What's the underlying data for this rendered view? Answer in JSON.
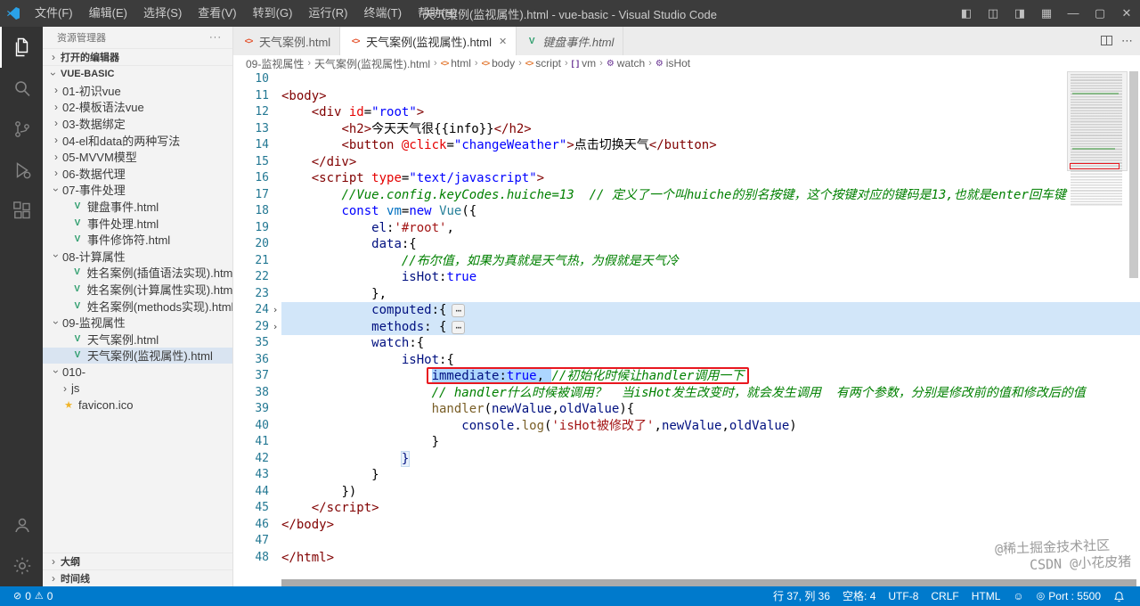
{
  "titlebar": {
    "menus": [
      "文件(F)",
      "编辑(E)",
      "选择(S)",
      "查看(V)",
      "转到(G)",
      "运行(R)",
      "终端(T)",
      "帮助(H)"
    ],
    "title": "天气案例(监视属性).html - vue-basic - Visual Studio Code"
  },
  "sidebar": {
    "title": "资源管理器",
    "open_editors_label": "打开的编辑器",
    "workspace_label": "VUE-BASIC",
    "outline_label": "大纲",
    "timeline_label": "时间线",
    "tree": [
      {
        "label": "01-初识vue",
        "kind": "folder",
        "state": "collapsed",
        "depth": 0
      },
      {
        "label": "02-模板语法vue",
        "kind": "folder",
        "state": "collapsed",
        "depth": 0
      },
      {
        "label": "03-数据绑定",
        "kind": "folder",
        "state": "collapsed",
        "depth": 0
      },
      {
        "label": "04-el和data的两种写法",
        "kind": "folder",
        "state": "collapsed",
        "depth": 0
      },
      {
        "label": "05-MVVM模型",
        "kind": "folder",
        "state": "collapsed",
        "depth": 0
      },
      {
        "label": "06-数据代理",
        "kind": "folder",
        "state": "collapsed",
        "depth": 0
      },
      {
        "label": "07-事件处理",
        "kind": "folder",
        "state": "expanded",
        "depth": 0
      },
      {
        "label": "键盘事件.html",
        "kind": "file",
        "icon": "vue",
        "depth": 1
      },
      {
        "label": "事件处理.html",
        "kind": "file",
        "icon": "vue",
        "depth": 1
      },
      {
        "label": "事件修饰符.html",
        "kind": "file",
        "icon": "vue",
        "depth": 1
      },
      {
        "label": "08-计算属性",
        "kind": "folder",
        "state": "expanded",
        "depth": 0
      },
      {
        "label": "姓名案例(插值语法实现).html",
        "kind": "file",
        "icon": "vue",
        "depth": 1
      },
      {
        "label": "姓名案例(计算属性实现).html",
        "kind": "file",
        "icon": "vue",
        "depth": 1
      },
      {
        "label": "姓名案例(methods实现).html",
        "kind": "file",
        "icon": "vue",
        "depth": 1
      },
      {
        "label": "09-监视属性",
        "kind": "folder",
        "state": "expanded",
        "depth": 0
      },
      {
        "label": "天气案例.html",
        "kind": "file",
        "icon": "vue",
        "depth": 1
      },
      {
        "label": "天气案例(监视属性).html",
        "kind": "file",
        "icon": "vue",
        "depth": 1,
        "selected": true
      },
      {
        "label": "010-",
        "kind": "folder",
        "state": "expanded",
        "depth": 0
      },
      {
        "label": "js",
        "kind": "folder",
        "state": "collapsed",
        "depth": 1
      },
      {
        "label": "favicon.ico",
        "kind": "file",
        "icon": "star",
        "depth": 0
      }
    ]
  },
  "tabs": [
    {
      "label": "天气案例.html",
      "icon": "html",
      "active": false,
      "preview": false
    },
    {
      "label": "天气案例(监视属性).html",
      "icon": "html",
      "active": true,
      "preview": false
    },
    {
      "label": "键盘事件.html",
      "icon": "vue",
      "active": false,
      "preview": true
    }
  ],
  "breadcrumbs": [
    {
      "label": "09-监视属性",
      "icon": ""
    },
    {
      "label": "天气案例(监视属性).html",
      "icon": ""
    },
    {
      "label": "html",
      "icon": "tag"
    },
    {
      "label": "body",
      "icon": "tag"
    },
    {
      "label": "script",
      "icon": "tag"
    },
    {
      "label": "vm",
      "icon": "field"
    },
    {
      "label": "watch",
      "icon": "method"
    },
    {
      "label": "isHot",
      "icon": "method"
    }
  ],
  "editor": {
    "highlighted_line": 37,
    "lines": [
      {
        "n": 10,
        "tk": []
      },
      {
        "n": 11,
        "tk": [
          {
            "t": "<body>",
            "c": "tag"
          }
        ]
      },
      {
        "n": 12,
        "tk": [
          {
            "t": "    ",
            "c": "pln"
          },
          {
            "t": "<div",
            "c": "tag"
          },
          {
            "t": " ",
            "c": "pln"
          },
          {
            "t": "id",
            "c": "attr"
          },
          {
            "t": "=",
            "c": "pln"
          },
          {
            "t": "\"root\"",
            "c": "aval"
          },
          {
            "t": ">",
            "c": "tag"
          }
        ]
      },
      {
        "n": 13,
        "tk": [
          {
            "t": "        ",
            "c": "pln"
          },
          {
            "t": "<h2>",
            "c": "tag"
          },
          {
            "t": "今天天气很{{info}}",
            "c": "pln"
          },
          {
            "t": "</h2>",
            "c": "tag"
          }
        ]
      },
      {
        "n": 14,
        "tk": [
          {
            "t": "        ",
            "c": "pln"
          },
          {
            "t": "<button",
            "c": "tag"
          },
          {
            "t": " ",
            "c": "pln"
          },
          {
            "t": "@click",
            "c": "attr"
          },
          {
            "t": "=",
            "c": "pln"
          },
          {
            "t": "\"changeWeather\"",
            "c": "aval"
          },
          {
            "t": ">",
            "c": "tag"
          },
          {
            "t": "点击切换天气",
            "c": "pln"
          },
          {
            "t": "</button>",
            "c": "tag"
          }
        ]
      },
      {
        "n": 15,
        "tk": [
          {
            "t": "    ",
            "c": "pln"
          },
          {
            "t": "</div>",
            "c": "tag"
          }
        ]
      },
      {
        "n": 16,
        "tk": [
          {
            "t": "    ",
            "c": "pln"
          },
          {
            "t": "<script",
            "c": "tag"
          },
          {
            "t": " ",
            "c": "pln"
          },
          {
            "t": "type",
            "c": "attr"
          },
          {
            "t": "=",
            "c": "pln"
          },
          {
            "t": "\"text/javascript\"",
            "c": "aval"
          },
          {
            "t": ">",
            "c": "tag"
          }
        ]
      },
      {
        "n": 17,
        "tk": [
          {
            "t": "        ",
            "c": "pln"
          },
          {
            "t": "//Vue.config.keyCodes.huiche=13  // 定义了一个叫huiche的别名按键，这个按键对应的键码是13,也就是enter回车键",
            "c": "cmt"
          }
        ]
      },
      {
        "n": 18,
        "tk": [
          {
            "t": "        ",
            "c": "pln"
          },
          {
            "t": "const",
            "c": "kw"
          },
          {
            "t": " ",
            "c": "pln"
          },
          {
            "t": "vm",
            "c": "vconst"
          },
          {
            "t": "=",
            "c": "pln"
          },
          {
            "t": "new",
            "c": "kw"
          },
          {
            "t": " ",
            "c": "pln"
          },
          {
            "t": "Vue",
            "c": "cls"
          },
          {
            "t": "({",
            "c": "pln"
          }
        ]
      },
      {
        "n": 19,
        "tk": [
          {
            "t": "            ",
            "c": "pln"
          },
          {
            "t": "el",
            "c": "prop"
          },
          {
            "t": ":",
            "c": "pln"
          },
          {
            "t": "'#root'",
            "c": "str"
          },
          {
            "t": ",",
            "c": "pln"
          }
        ]
      },
      {
        "n": 20,
        "tk": [
          {
            "t": "            ",
            "c": "pln"
          },
          {
            "t": "data",
            "c": "prop"
          },
          {
            "t": ":{",
            "c": "pln"
          }
        ]
      },
      {
        "n": 21,
        "tk": [
          {
            "t": "                ",
            "c": "pln"
          },
          {
            "t": "//布尔值，如果为真就是天气热，为假就是天气冷",
            "c": "cmt"
          }
        ]
      },
      {
        "n": 22,
        "tk": [
          {
            "t": "                ",
            "c": "pln"
          },
          {
            "t": "isHot",
            "c": "prop"
          },
          {
            "t": ":",
            "c": "pln"
          },
          {
            "t": "true",
            "c": "kw"
          }
        ]
      },
      {
        "n": 23,
        "tk": [
          {
            "t": "            ",
            "c": "pln"
          },
          {
            "t": "},",
            "c": "pln"
          }
        ]
      },
      {
        "n": 24,
        "fold": true,
        "tk": [
          {
            "t": "            ",
            "c": "pln"
          },
          {
            "t": "computed",
            "c": "prop"
          },
          {
            "t": ":{",
            "c": "pln"
          },
          {
            "t": "⋯",
            "c": "foldbadge"
          }
        ]
      },
      {
        "n": 29,
        "fold": true,
        "tk": [
          {
            "t": "            ",
            "c": "pln"
          },
          {
            "t": "methods",
            "c": "prop"
          },
          {
            "t": ": {",
            "c": "pln"
          },
          {
            "t": "⋯",
            "c": "foldbadge"
          }
        ]
      },
      {
        "n": 35,
        "tk": [
          {
            "t": "            ",
            "c": "pln"
          },
          {
            "t": "watch",
            "c": "prop"
          },
          {
            "t": ":{",
            "c": "pln"
          }
        ]
      },
      {
        "n": 36,
        "tk": [
          {
            "t": "                ",
            "c": "pln"
          },
          {
            "t": "isHot",
            "c": "prop"
          },
          {
            "t": ":{",
            "c": "pln"
          }
        ]
      },
      {
        "n": 37,
        "tk": [
          {
            "t": "                    ",
            "c": "pln"
          },
          {
            "t": "immediate",
            "c": "prop",
            "h": 1,
            "b": 1
          },
          {
            "t": ":",
            "c": "pln",
            "h": 1,
            "b": 1
          },
          {
            "t": "true",
            "c": "kw",
            "h": 1,
            "b": 1
          },
          {
            "t": ", ",
            "c": "pln",
            "h": 1,
            "b": 1
          },
          {
            "t": "//初始化时候让handler调用一下",
            "c": "cmt",
            "b": 1
          }
        ]
      },
      {
        "n": 38,
        "tk": [
          {
            "t": "                    ",
            "c": "pln"
          },
          {
            "t": "// handler什么时候被调用？  当isHot发生改变时，就会发生调用  有两个参数，分别是修改前的值和修改后的值",
            "c": "cmt"
          }
        ]
      },
      {
        "n": 39,
        "tk": [
          {
            "t": "                    ",
            "c": "pln"
          },
          {
            "t": "handler",
            "c": "fn"
          },
          {
            "t": "(",
            "c": "pln"
          },
          {
            "t": "newValue",
            "c": "prop"
          },
          {
            "t": ",",
            "c": "pln"
          },
          {
            "t": "oldValue",
            "c": "prop"
          },
          {
            "t": "){",
            "c": "pln"
          }
        ]
      },
      {
        "n": 40,
        "tk": [
          {
            "t": "                        ",
            "c": "pln"
          },
          {
            "t": "console",
            "c": "prop"
          },
          {
            "t": ".",
            "c": "pln"
          },
          {
            "t": "log",
            "c": "fn"
          },
          {
            "t": "(",
            "c": "pln"
          },
          {
            "t": "'isHot被修改了'",
            "c": "str"
          },
          {
            "t": ",",
            "c": "pln"
          },
          {
            "t": "newValue",
            "c": "prop"
          },
          {
            "t": ",",
            "c": "pln"
          },
          {
            "t": "oldValue",
            "c": "prop"
          },
          {
            "t": ")",
            "c": "pln"
          }
        ]
      },
      {
        "n": 41,
        "tk": [
          {
            "t": "                    ",
            "c": "pln"
          },
          {
            "t": "}",
            "c": "pln"
          }
        ]
      },
      {
        "n": 42,
        "tk": [
          {
            "t": "                ",
            "c": "pln"
          },
          {
            "t": "}",
            "c": "bm"
          }
        ]
      },
      {
        "n": 43,
        "tk": [
          {
            "t": "            ",
            "c": "pln"
          },
          {
            "t": "}",
            "c": "pln"
          }
        ]
      },
      {
        "n": 44,
        "tk": [
          {
            "t": "        ",
            "c": "pln"
          },
          {
            "t": "})",
            "c": "pln"
          }
        ]
      },
      {
        "n": 45,
        "tk": [
          {
            "t": "    ",
            "c": "pln"
          },
          {
            "t": "</script>",
            "c": "tag"
          }
        ]
      },
      {
        "n": 46,
        "tk": [
          {
            "t": "</body>",
            "c": "tag"
          }
        ]
      },
      {
        "n": 47,
        "tk": []
      },
      {
        "n": 48,
        "tk": [
          {
            "t": "</html>",
            "c": "tag"
          }
        ]
      }
    ]
  },
  "watermarks": [
    "@稀土掘金技术社区",
    "CSDN @小花皮猪"
  ],
  "statusbar": {
    "errors": "0",
    "warnings": "0",
    "cursor": "行 37, 列 36",
    "indent": "空格: 4",
    "encoding": "UTF-8",
    "eol": "CRLF",
    "language": "HTML",
    "live_server": "Port : 5500"
  },
  "colors": {
    "statusbar_bg": "#007acc",
    "titlebar_bg": "#3c3c3c",
    "activitybar_bg": "#333333",
    "sidebar_bg": "#f3f3f3",
    "annotation_red": "#e8171f",
    "fold_row_highlight": "#d2e6f9",
    "selection_highlight": "#add6ff"
  }
}
